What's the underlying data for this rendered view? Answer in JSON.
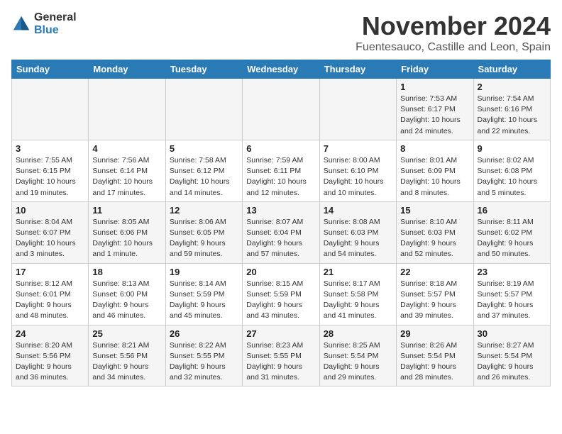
{
  "header": {
    "logo_general": "General",
    "logo_blue": "Blue",
    "month_title": "November 2024",
    "location": "Fuentesauco, Castille and Leon, Spain"
  },
  "days_of_week": [
    "Sunday",
    "Monday",
    "Tuesday",
    "Wednesday",
    "Thursday",
    "Friday",
    "Saturday"
  ],
  "weeks": [
    [
      {
        "day": "",
        "info": ""
      },
      {
        "day": "",
        "info": ""
      },
      {
        "day": "",
        "info": ""
      },
      {
        "day": "",
        "info": ""
      },
      {
        "day": "",
        "info": ""
      },
      {
        "day": "1",
        "info": "Sunrise: 7:53 AM\nSunset: 6:17 PM\nDaylight: 10 hours and 24 minutes."
      },
      {
        "day": "2",
        "info": "Sunrise: 7:54 AM\nSunset: 6:16 PM\nDaylight: 10 hours and 22 minutes."
      }
    ],
    [
      {
        "day": "3",
        "info": "Sunrise: 7:55 AM\nSunset: 6:15 PM\nDaylight: 10 hours and 19 minutes."
      },
      {
        "day": "4",
        "info": "Sunrise: 7:56 AM\nSunset: 6:14 PM\nDaylight: 10 hours and 17 minutes."
      },
      {
        "day": "5",
        "info": "Sunrise: 7:58 AM\nSunset: 6:12 PM\nDaylight: 10 hours and 14 minutes."
      },
      {
        "day": "6",
        "info": "Sunrise: 7:59 AM\nSunset: 6:11 PM\nDaylight: 10 hours and 12 minutes."
      },
      {
        "day": "7",
        "info": "Sunrise: 8:00 AM\nSunset: 6:10 PM\nDaylight: 10 hours and 10 minutes."
      },
      {
        "day": "8",
        "info": "Sunrise: 8:01 AM\nSunset: 6:09 PM\nDaylight: 10 hours and 8 minutes."
      },
      {
        "day": "9",
        "info": "Sunrise: 8:02 AM\nSunset: 6:08 PM\nDaylight: 10 hours and 5 minutes."
      }
    ],
    [
      {
        "day": "10",
        "info": "Sunrise: 8:04 AM\nSunset: 6:07 PM\nDaylight: 10 hours and 3 minutes."
      },
      {
        "day": "11",
        "info": "Sunrise: 8:05 AM\nSunset: 6:06 PM\nDaylight: 10 hours and 1 minute."
      },
      {
        "day": "12",
        "info": "Sunrise: 8:06 AM\nSunset: 6:05 PM\nDaylight: 9 hours and 59 minutes."
      },
      {
        "day": "13",
        "info": "Sunrise: 8:07 AM\nSunset: 6:04 PM\nDaylight: 9 hours and 57 minutes."
      },
      {
        "day": "14",
        "info": "Sunrise: 8:08 AM\nSunset: 6:03 PM\nDaylight: 9 hours and 54 minutes."
      },
      {
        "day": "15",
        "info": "Sunrise: 8:10 AM\nSunset: 6:03 PM\nDaylight: 9 hours and 52 minutes."
      },
      {
        "day": "16",
        "info": "Sunrise: 8:11 AM\nSunset: 6:02 PM\nDaylight: 9 hours and 50 minutes."
      }
    ],
    [
      {
        "day": "17",
        "info": "Sunrise: 8:12 AM\nSunset: 6:01 PM\nDaylight: 9 hours and 48 minutes."
      },
      {
        "day": "18",
        "info": "Sunrise: 8:13 AM\nSunset: 6:00 PM\nDaylight: 9 hours and 46 minutes."
      },
      {
        "day": "19",
        "info": "Sunrise: 8:14 AM\nSunset: 5:59 PM\nDaylight: 9 hours and 45 minutes."
      },
      {
        "day": "20",
        "info": "Sunrise: 8:15 AM\nSunset: 5:59 PM\nDaylight: 9 hours and 43 minutes."
      },
      {
        "day": "21",
        "info": "Sunrise: 8:17 AM\nSunset: 5:58 PM\nDaylight: 9 hours and 41 minutes."
      },
      {
        "day": "22",
        "info": "Sunrise: 8:18 AM\nSunset: 5:57 PM\nDaylight: 9 hours and 39 minutes."
      },
      {
        "day": "23",
        "info": "Sunrise: 8:19 AM\nSunset: 5:57 PM\nDaylight: 9 hours and 37 minutes."
      }
    ],
    [
      {
        "day": "24",
        "info": "Sunrise: 8:20 AM\nSunset: 5:56 PM\nDaylight: 9 hours and 36 minutes."
      },
      {
        "day": "25",
        "info": "Sunrise: 8:21 AM\nSunset: 5:56 PM\nDaylight: 9 hours and 34 minutes."
      },
      {
        "day": "26",
        "info": "Sunrise: 8:22 AM\nSunset: 5:55 PM\nDaylight: 9 hours and 32 minutes."
      },
      {
        "day": "27",
        "info": "Sunrise: 8:23 AM\nSunset: 5:55 PM\nDaylight: 9 hours and 31 minutes."
      },
      {
        "day": "28",
        "info": "Sunrise: 8:25 AM\nSunset: 5:54 PM\nDaylight: 9 hours and 29 minutes."
      },
      {
        "day": "29",
        "info": "Sunrise: 8:26 AM\nSunset: 5:54 PM\nDaylight: 9 hours and 28 minutes."
      },
      {
        "day": "30",
        "info": "Sunrise: 8:27 AM\nSunset: 5:54 PM\nDaylight: 9 hours and 26 minutes."
      }
    ]
  ]
}
